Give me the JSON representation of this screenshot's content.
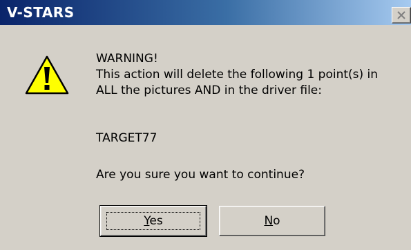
{
  "window": {
    "title": "V-STARS"
  },
  "message": {
    "lines": [
      "WARNING!",
      "This action will delete the following 1 point(s) in",
      "ALL the pictures AND in the driver file:"
    ],
    "target": "TARGET77",
    "question": "Are you sure you want to continue?"
  },
  "buttons": {
    "yes": {
      "mnemonic": "Y",
      "rest": "es"
    },
    "no": {
      "mnemonic": "N",
      "rest": "o"
    }
  },
  "icons": {
    "warning": "warning-icon",
    "close": "close-icon"
  },
  "colors": {
    "titlebar_start": "#0a246a",
    "titlebar_end": "#a6caf0",
    "dialog_bg": "#d4d0c8",
    "warning_fill": "#ffff00"
  }
}
